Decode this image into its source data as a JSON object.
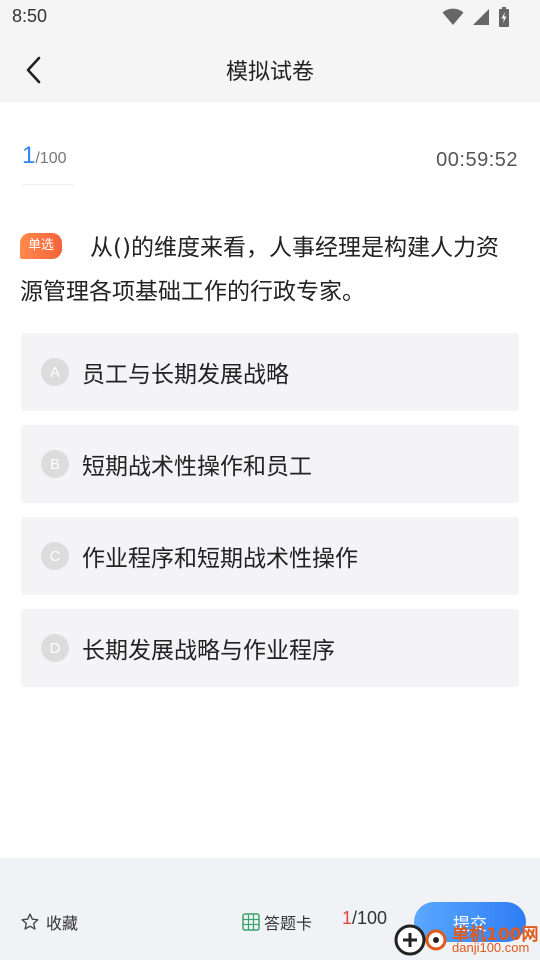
{
  "status_bar": {
    "time": "8:50"
  },
  "nav": {
    "title": "模拟试卷"
  },
  "progress": {
    "current": "1",
    "total": "/100"
  },
  "timer": "00:59:52",
  "question": {
    "type": "单选",
    "text": "从()的维度来看，人事经理是构建人力资源管理各项基础工作的行政专家。"
  },
  "options": [
    {
      "letter": "A",
      "text": "员工与长期发展战略"
    },
    {
      "letter": "B",
      "text": "短期战术性操作和员工"
    },
    {
      "letter": "C",
      "text": "作业程序和短期战术性操作"
    },
    {
      "letter": "D",
      "text": "长期发展战略与作业程序"
    }
  ],
  "bottom_bar": {
    "favorite_label": "收藏",
    "answer_card_label": "答题卡",
    "progress_current": "1",
    "progress_total": "/100",
    "submit_label": "提交"
  },
  "watermark": {
    "text": "单机100网",
    "sub": "danji100.com"
  },
  "colors": {
    "accent": "#2f86f6",
    "badge": "#f5633a",
    "progress_current_red": "#e0473b",
    "submit": "#2f7df6"
  }
}
